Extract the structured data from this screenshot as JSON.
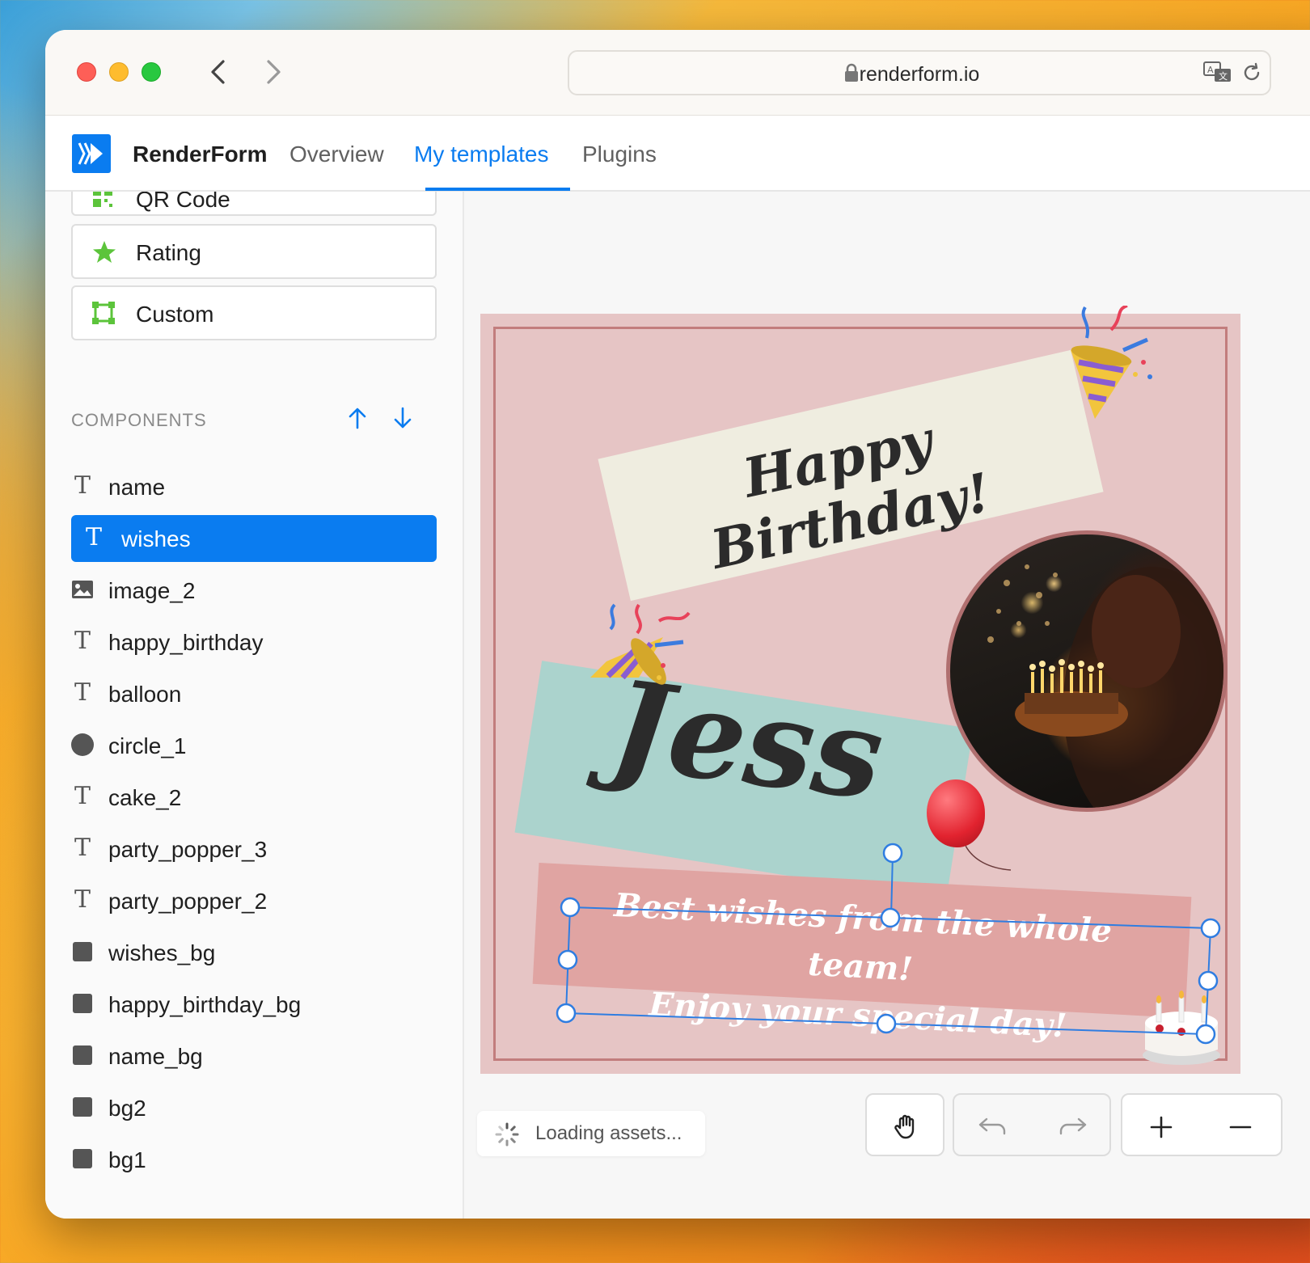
{
  "browser": {
    "url": "renderform.io"
  },
  "app": {
    "brand": "RenderForm",
    "nav": [
      "Overview",
      "My templates",
      "Plugins"
    ],
    "active_nav": "My templates"
  },
  "sidebar": {
    "buttons": [
      {
        "label": "QR Code",
        "icon": "qr-code-icon"
      },
      {
        "label": "Rating",
        "icon": "star-icon"
      },
      {
        "label": "Custom",
        "icon": "custom-shape-icon"
      }
    ],
    "components_header": "COMPONENTS",
    "components": [
      {
        "label": "name",
        "icon": "text-icon"
      },
      {
        "label": "wishes",
        "icon": "text-icon",
        "selected": true
      },
      {
        "label": "image_2",
        "icon": "image-icon"
      },
      {
        "label": "happy_birthday",
        "icon": "text-icon"
      },
      {
        "label": "balloon",
        "icon": "text-icon"
      },
      {
        "label": "circle_1",
        "icon": "circle-icon"
      },
      {
        "label": "cake_2",
        "icon": "text-icon"
      },
      {
        "label": "party_popper_3",
        "icon": "text-icon"
      },
      {
        "label": "party_popper_2",
        "icon": "text-icon"
      },
      {
        "label": "wishes_bg",
        "icon": "rectangle-icon"
      },
      {
        "label": "happy_birthday_bg",
        "icon": "rectangle-icon"
      },
      {
        "label": "name_bg",
        "icon": "rectangle-icon"
      },
      {
        "label": "bg2",
        "icon": "rectangle-icon"
      },
      {
        "label": "bg1",
        "icon": "rectangle-icon"
      }
    ]
  },
  "canvas": {
    "happy_birthday": "Happy Birthday!",
    "name": "Jess",
    "wishes_line1": "Best wishes from the whole team!",
    "wishes_line2": "Enjoy your special day!"
  },
  "status": {
    "loading": "Loading assets..."
  },
  "colors": {
    "accent": "#0a7cf0",
    "card_bg": "#e6c5c5",
    "name_bg": "#abd3cd",
    "happy_birthday_bg": "#efede0",
    "wishes_bg": "#e0a4a2"
  }
}
